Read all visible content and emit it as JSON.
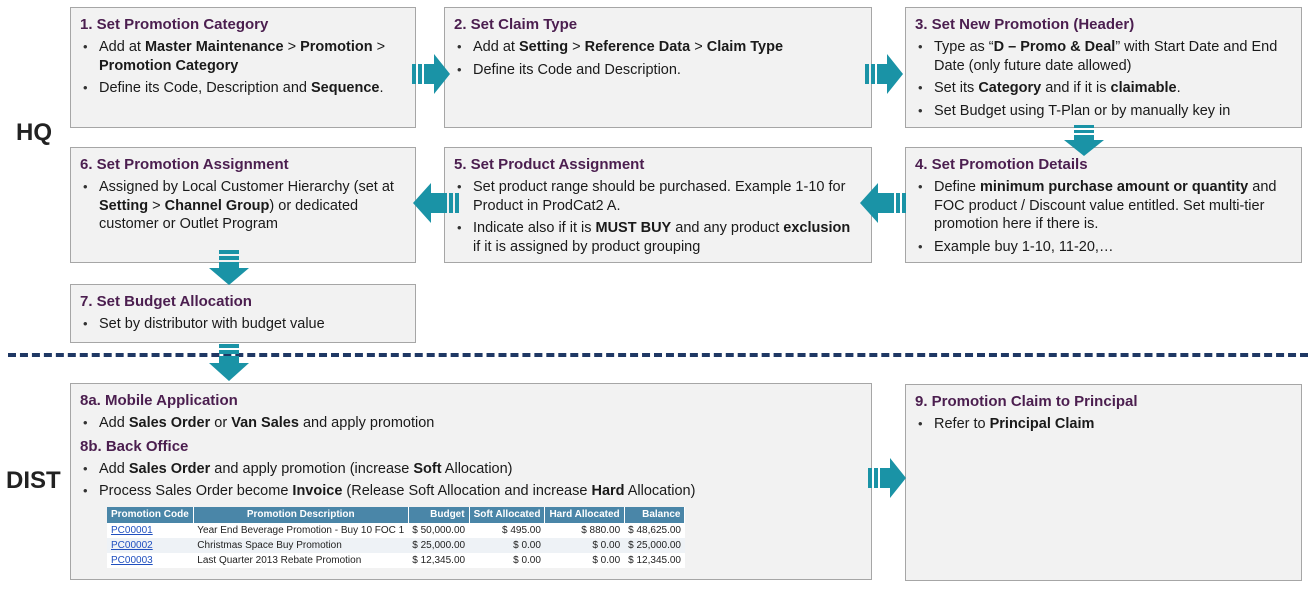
{
  "sections": {
    "hq": "HQ",
    "dist": "DIST"
  },
  "boxes": {
    "b1": {
      "title": "1.   Set Promotion Category",
      "items": [
        [
          {
            "t": "Add at "
          },
          {
            "t": "Master Maintenance",
            "b": true
          },
          {
            "t": " > "
          },
          {
            "t": "Promotion",
            "b": true
          },
          {
            "t": " > "
          },
          {
            "t": "Promotion Category",
            "b": true
          }
        ],
        [
          {
            "t": "Define its Code, Description and "
          },
          {
            "t": "Sequence",
            "b": true
          },
          {
            "t": "."
          }
        ]
      ]
    },
    "b2": {
      "title": "2. Set Claim Type",
      "items": [
        [
          {
            "t": "Add at "
          },
          {
            "t": "Setting",
            "b": true
          },
          {
            "t": " > "
          },
          {
            "t": "Reference Data",
            "b": true
          },
          {
            "t": " > "
          },
          {
            "t": "Claim Type",
            "b": true
          }
        ],
        [
          {
            "t": "Define its Code and Description."
          }
        ]
      ]
    },
    "b3": {
      "title": "3. Set New Promotion (Header)",
      "items": [
        [
          {
            "t": "Type as “"
          },
          {
            "t": "D – Promo & Deal",
            "b": true
          },
          {
            "t": "” with Start Date and End Date (only future date allowed)"
          }
        ],
        [
          {
            "t": "Set its "
          },
          {
            "t": "Category",
            "b": true
          },
          {
            "t": " and if it is "
          },
          {
            "t": "claimable",
            "b": true
          },
          {
            "t": "."
          }
        ],
        [
          {
            "t": "Set Budget using T-Plan or by manually key in"
          }
        ]
      ]
    },
    "b4": {
      "title": "4. Set Promotion Details",
      "items": [
        [
          {
            "t": "Define "
          },
          {
            "t": "minimum purchase amount or quantity",
            "b": true
          },
          {
            "t": " and FOC product / Discount value entitled. Set multi-tier promotion here if there is."
          }
        ],
        [
          {
            "t": "Example buy 1-10, 11-20,…"
          }
        ]
      ]
    },
    "b5": {
      "title": "5. Set Product Assignment",
      "items": [
        [
          {
            "t": "Set product range should be purchased. Example 1-10 for Product in ProdCat2 A."
          }
        ],
        [
          {
            "t": "Indicate also if it is "
          },
          {
            "t": "MUST BUY",
            "b": true
          },
          {
            "t": " and any product "
          },
          {
            "t": "exclusion",
            "b": true
          },
          {
            "t": " if it is assigned by product grouping"
          }
        ]
      ]
    },
    "b6": {
      "title": "6. Set Promotion Assignment",
      "items": [
        [
          {
            "t": "Assigned by Local Customer Hierarchy (set at "
          },
          {
            "t": "Setting",
            "b": true
          },
          {
            "t": " > "
          },
          {
            "t": "Channel Group",
            "b": true
          },
          {
            "t": ") or dedicated customer or Outlet Program"
          }
        ]
      ]
    },
    "b7": {
      "title": "7. Set Budget Allocation",
      "items": [
        [
          {
            "t": "Set by distributor with budget value"
          }
        ]
      ]
    },
    "b8": {
      "title_a": "8a. Mobile Application",
      "items_a": [
        [
          {
            "t": "Add "
          },
          {
            "t": "Sales Order",
            "b": true
          },
          {
            "t": " or "
          },
          {
            "t": "Van Sales",
            "b": true
          },
          {
            "t": " and apply promotion"
          }
        ]
      ],
      "title_b": "8b. Back Office",
      "items_b": [
        [
          {
            "t": "Add "
          },
          {
            "t": "Sales Order",
            "b": true
          },
          {
            "t": " and apply promotion (increase "
          },
          {
            "t": "Soft",
            "b": true
          },
          {
            "t": " Allocation)"
          }
        ],
        [
          {
            "t": "Process Sales Order become "
          },
          {
            "t": "Invoice",
            "b": true
          },
          {
            "t": " (Release Soft Allocation and increase "
          },
          {
            "t": "Hard",
            "b": true
          },
          {
            "t": " Allocation)"
          }
        ]
      ]
    },
    "b9": {
      "title": "9. Promotion Claim to Principal",
      "items": [
        [
          {
            "t": "Refer to "
          },
          {
            "t": "Principal Claim",
            "b": true
          }
        ]
      ]
    }
  },
  "promo_table": {
    "headers": [
      "Promotion Code",
      "Promotion Description",
      "Budget",
      "Soft Allocated",
      "Hard Allocated",
      "Balance"
    ],
    "rows": [
      [
        "PC00001",
        "Year End Beverage Promotion - Buy 10 FOC 1",
        "$ 50,000.00",
        "$ 495.00",
        "$ 880.00",
        "$ 48,625.00"
      ],
      [
        "PC00002",
        "Christmas Space Buy Promotion",
        "$ 25,000.00",
        "$ 0.00",
        "$ 0.00",
        "$ 25,000.00"
      ],
      [
        "PC00003",
        "Last Quarter 2013 Rebate Promotion",
        "$ 12,345.00",
        "$ 0.00",
        "$ 0.00",
        "$ 12,345.00"
      ]
    ]
  },
  "colors": {
    "title": "#4b1e4f",
    "arrow": "#1a93a6",
    "divider": "#1f3864",
    "table_header": "#4a86a8"
  }
}
